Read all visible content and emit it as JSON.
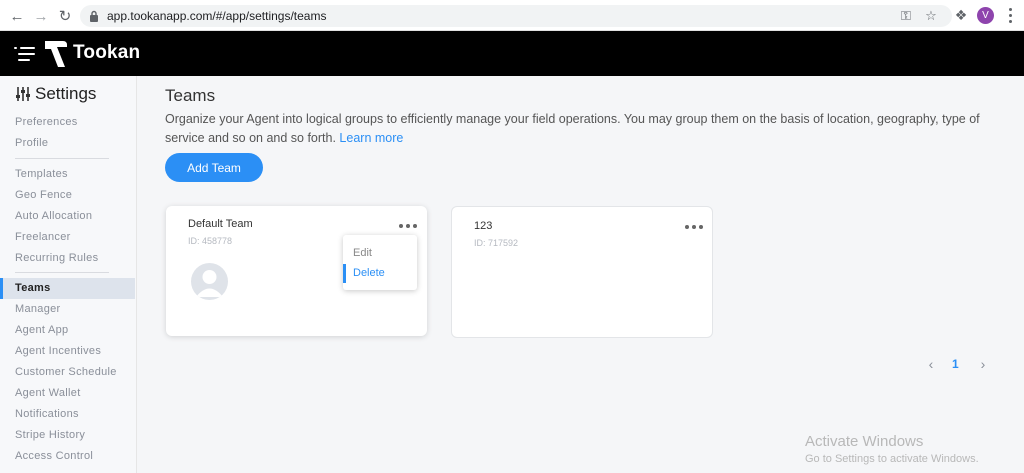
{
  "browser": {
    "url": "app.tookanapp.com/#/app/settings/teams",
    "back_icon": "arrow-left-icon",
    "forward_icon": "arrow-right-icon",
    "reload_icon": "reload-icon",
    "profile_initial": "V",
    "profile_color": "#8e44ad"
  },
  "header": {
    "brand": "Tookan",
    "menu_icon": "hamburger-icon"
  },
  "sidebar": {
    "title": "Settings",
    "items": [
      {
        "label": "Preferences"
      },
      {
        "label": "Profile"
      },
      {
        "label": "Templates"
      },
      {
        "label": "Geo Fence"
      },
      {
        "label": "Auto Allocation"
      },
      {
        "label": "Freelancer"
      },
      {
        "label": "Recurring Rules"
      },
      {
        "label": "Teams"
      },
      {
        "label": "Manager"
      },
      {
        "label": "Agent App"
      },
      {
        "label": "Agent Incentives"
      },
      {
        "label": "Customer Schedule"
      },
      {
        "label": "Agent Wallet"
      },
      {
        "label": "Notifications"
      },
      {
        "label": "Stripe History"
      },
      {
        "label": "Access Control"
      }
    ],
    "active_item": "Teams"
  },
  "main": {
    "title": "Teams",
    "description": "Organize your Agent into logical groups to efficiently manage your field operations. You may group them on the basis of location, geography, type of service and so on and so forth.",
    "learn_more": "Learn more",
    "add_team_label": "Add Team",
    "teams": [
      {
        "name": "Default Team",
        "id_text": "ID: 458778"
      },
      {
        "name": "123",
        "id_text": "ID: 717592"
      }
    ],
    "dropdown": {
      "items": [
        "Edit",
        "Delete"
      ],
      "selected": "Delete"
    },
    "pagination": {
      "current_page": "1",
      "prev_icon": "chevron-left-icon",
      "next_icon": "chevron-right-icon"
    }
  },
  "watermark": {
    "title": "Activate Windows",
    "subtitle": "Go to Settings to activate Windows."
  },
  "colors": {
    "accent": "#2b8ff5",
    "header_bg": "#000000",
    "active_sidebar_bg": "#dde3ec"
  }
}
